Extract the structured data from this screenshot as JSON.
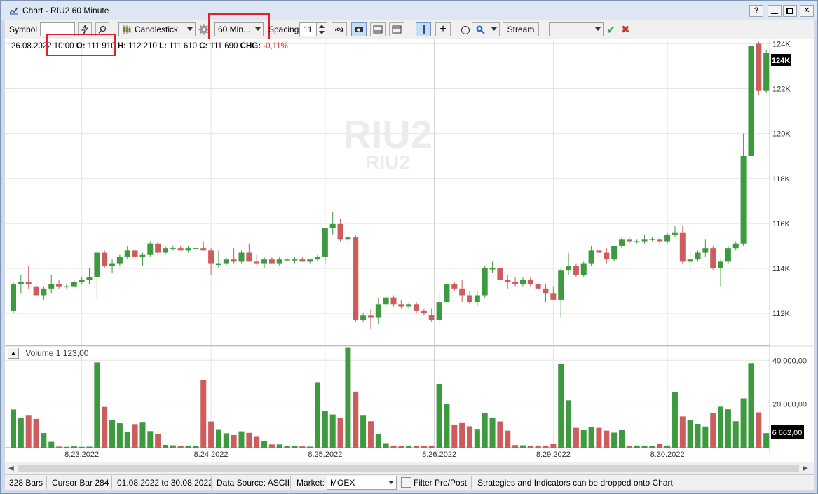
{
  "window": {
    "title": "Chart - RIU2 60 Minute",
    "help": "?",
    "minimize": "—",
    "maximize": "□",
    "close": "✕"
  },
  "toolbar": {
    "symbol_label": "Symbol",
    "symbol_value": "",
    "chart_style": "Candlestick",
    "timeframe": "60 Min...",
    "spacing_label": "Spacing",
    "spacing_value": "11",
    "log_label": "log",
    "stream_label": "Stream",
    "strategy_value": ""
  },
  "info": {
    "date": "26.08.2022",
    "time": "10:00",
    "o_label": "O:",
    "o_value": "111 910",
    "h_label": "H:",
    "h_value": "112 210",
    "l_label": "L:",
    "l_value": "111 610",
    "c_label": "C:",
    "c_value": "111 690",
    "chg_label": "CHG:",
    "chg_value": "-0,11%"
  },
  "watermark": {
    "big": "RIU2",
    "small": "RIU2"
  },
  "volume_panel": {
    "label": "Volume 1 123,00",
    "last_value_label": "6 662,00"
  },
  "price_tag": "124K",
  "status": {
    "bars": "328 Bars",
    "cursor": "Cursor Bar 284",
    "range": "01.08.2022 to 30.08.2022",
    "source": "Data Source: ASCII",
    "market_label": "Market:",
    "market_value": "MOEX",
    "filter_label": "Filter Pre/Post",
    "hint": "Strategies and Indicators can be dropped onto Chart"
  },
  "colors": {
    "up": "#3e9a3e",
    "down": "#cd5c5c",
    "grid": "#e4e4e4",
    "crosshair": "#c8c8c8",
    "highlight": "#e0202c"
  },
  "chart_data": [
    {
      "type": "candlestick",
      "series": [
        {
          "name": "RIU2",
          "values": [
            {
              "o": 112100,
              "h": 113400,
              "l": 112000,
              "c": 113300
            },
            {
              "o": 113300,
              "h": 113700,
              "l": 112900,
              "c": 113400
            },
            {
              "o": 113400,
              "h": 114100,
              "l": 113100,
              "c": 113300
            },
            {
              "o": 113200,
              "h": 113500,
              "l": 112700,
              "c": 112800
            },
            {
              "o": 112800,
              "h": 113200,
              "l": 112600,
              "c": 113100
            },
            {
              "o": 113100,
              "h": 113700,
              "l": 112900,
              "c": 113300
            },
            {
              "o": 113300,
              "h": 113500,
              "l": 113100,
              "c": 113200
            },
            {
              "o": 113200,
              "h": 113300,
              "l": 113100,
              "c": 113200
            },
            {
              "o": 113200,
              "h": 113500,
              "l": 113100,
              "c": 113400
            },
            {
              "o": 113400,
              "h": 113600,
              "l": 113300,
              "c": 113500
            },
            {
              "o": 113500,
              "h": 114000,
              "l": 113300,
              "c": 113600
            },
            {
              "o": 113600,
              "h": 114800,
              "l": 112700,
              "c": 114700
            },
            {
              "o": 114700,
              "h": 114800,
              "l": 114000,
              "c": 114100
            },
            {
              "o": 114100,
              "h": 114400,
              "l": 113800,
              "c": 114200
            },
            {
              "o": 114200,
              "h": 114600,
              "l": 114100,
              "c": 114500
            },
            {
              "o": 114500,
              "h": 115000,
              "l": 114400,
              "c": 114800
            },
            {
              "o": 114800,
              "h": 115000,
              "l": 114400,
              "c": 114500
            },
            {
              "o": 114500,
              "h": 114700,
              "l": 114100,
              "c": 114600
            },
            {
              "o": 114600,
              "h": 115200,
              "l": 114500,
              "c": 115100
            },
            {
              "o": 115100,
              "h": 115200,
              "l": 114600,
              "c": 114700
            },
            {
              "o": 114700,
              "h": 115000,
              "l": 114600,
              "c": 114900
            },
            {
              "o": 114900,
              "h": 115000,
              "l": 114800,
              "c": 114900
            },
            {
              "o": 114900,
              "h": 115000,
              "l": 114800,
              "c": 114800
            },
            {
              "o": 114800,
              "h": 115000,
              "l": 114700,
              "c": 114900
            },
            {
              "o": 114900,
              "h": 115000,
              "l": 114800,
              "c": 114900
            },
            {
              "o": 114900,
              "h": 115200,
              "l": 114800,
              "c": 114800
            },
            {
              "o": 114800,
              "h": 114900,
              "l": 113700,
              "c": 114200
            },
            {
              "o": 114200,
              "h": 114800,
              "l": 114000,
              "c": 114200
            },
            {
              "o": 114200,
              "h": 114500,
              "l": 114100,
              "c": 114400
            },
            {
              "o": 114400,
              "h": 114900,
              "l": 114200,
              "c": 114300
            },
            {
              "o": 114300,
              "h": 114800,
              "l": 114200,
              "c": 114700
            },
            {
              "o": 114700,
              "h": 115100,
              "l": 114300,
              "c": 114300
            },
            {
              "o": 114300,
              "h": 114600,
              "l": 114100,
              "c": 114200
            },
            {
              "o": 114200,
              "h": 114500,
              "l": 114000,
              "c": 114400
            },
            {
              "o": 114400,
              "h": 114500,
              "l": 114200,
              "c": 114200
            },
            {
              "o": 114200,
              "h": 114500,
              "l": 114100,
              "c": 114400
            },
            {
              "o": 114400,
              "h": 114500,
              "l": 114300,
              "c": 114400
            },
            {
              "o": 114400,
              "h": 114500,
              "l": 114200,
              "c": 114400
            },
            {
              "o": 114400,
              "h": 114500,
              "l": 114300,
              "c": 114300
            },
            {
              "o": 114300,
              "h": 114400,
              "l": 114200,
              "c": 114400
            },
            {
              "o": 114400,
              "h": 114600,
              "l": 114300,
              "c": 114500
            },
            {
              "o": 114500,
              "h": 115800,
              "l": 114200,
              "c": 115800
            },
            {
              "o": 115800,
              "h": 116500,
              "l": 115500,
              "c": 116000
            },
            {
              "o": 116000,
              "h": 116200,
              "l": 115200,
              "c": 115300
            },
            {
              "o": 115300,
              "h": 115500,
              "l": 115100,
              "c": 115400
            },
            {
              "o": 115400,
              "h": 115500,
              "l": 111600,
              "c": 111700
            },
            {
              "o": 111700,
              "h": 112000,
              "l": 111600,
              "c": 111900
            },
            {
              "o": 111900,
              "h": 112200,
              "l": 111300,
              "c": 111800
            },
            {
              "o": 111800,
              "h": 112700,
              "l": 111500,
              "c": 112400
            },
            {
              "o": 112400,
              "h": 112800,
              "l": 112200,
              "c": 112700
            },
            {
              "o": 112700,
              "h": 112800,
              "l": 112300,
              "c": 112400
            },
            {
              "o": 112400,
              "h": 112600,
              "l": 112200,
              "c": 112300
            },
            {
              "o": 112300,
              "h": 112500,
              "l": 112200,
              "c": 112400
            },
            {
              "o": 112400,
              "h": 112500,
              "l": 112000,
              "c": 112100
            },
            {
              "o": 112100,
              "h": 112200,
              "l": 111900,
              "c": 112000
            },
            {
              "o": 111910,
              "h": 112210,
              "l": 111610,
              "c": 111690
            },
            {
              "o": 111700,
              "h": 113000,
              "l": 111500,
              "c": 112500
            },
            {
              "o": 112500,
              "h": 113400,
              "l": 112300,
              "c": 113300
            },
            {
              "o": 113300,
              "h": 113400,
              "l": 113000,
              "c": 113100
            },
            {
              "o": 113100,
              "h": 113500,
              "l": 112500,
              "c": 112800
            },
            {
              "o": 112800,
              "h": 113000,
              "l": 112400,
              "c": 112500
            },
            {
              "o": 112500,
              "h": 113000,
              "l": 112300,
              "c": 112800
            },
            {
              "o": 112800,
              "h": 114100,
              "l": 112700,
              "c": 114000
            },
            {
              "o": 114000,
              "h": 114300,
              "l": 113800,
              "c": 114000
            },
            {
              "o": 114000,
              "h": 114300,
              "l": 113300,
              "c": 113500
            },
            {
              "o": 113500,
              "h": 113700,
              "l": 113100,
              "c": 113400
            },
            {
              "o": 113400,
              "h": 113600,
              "l": 113200,
              "c": 113300
            },
            {
              "o": 113300,
              "h": 113600,
              "l": 113200,
              "c": 113500
            },
            {
              "o": 113500,
              "h": 113600,
              "l": 113200,
              "c": 113300
            },
            {
              "o": 113300,
              "h": 113400,
              "l": 113000,
              "c": 113100
            },
            {
              "o": 113100,
              "h": 113300,
              "l": 112500,
              "c": 112900
            },
            {
              "o": 112900,
              "h": 113200,
              "l": 112600,
              "c": 112600
            },
            {
              "o": 112600,
              "h": 114000,
              "l": 111800,
              "c": 113900
            },
            {
              "o": 113900,
              "h": 114700,
              "l": 113700,
              "c": 114100
            },
            {
              "o": 114100,
              "h": 114200,
              "l": 113600,
              "c": 113700
            },
            {
              "o": 113700,
              "h": 114300,
              "l": 113600,
              "c": 114200
            },
            {
              "o": 114200,
              "h": 115000,
              "l": 114100,
              "c": 114800
            },
            {
              "o": 114800,
              "h": 115000,
              "l": 114500,
              "c": 114700
            },
            {
              "o": 114700,
              "h": 114900,
              "l": 114200,
              "c": 114400
            },
            {
              "o": 114400,
              "h": 115000,
              "l": 114300,
              "c": 115000
            },
            {
              "o": 115000,
              "h": 115400,
              "l": 114900,
              "c": 115300
            },
            {
              "o": 115300,
              "h": 115400,
              "l": 115100,
              "c": 115200
            },
            {
              "o": 115200,
              "h": 115300,
              "l": 115100,
              "c": 115200
            },
            {
              "o": 115200,
              "h": 115500,
              "l": 115100,
              "c": 115300
            },
            {
              "o": 115300,
              "h": 115400,
              "l": 115200,
              "c": 115300
            },
            {
              "o": 115300,
              "h": 115400,
              "l": 115100,
              "c": 115200
            },
            {
              "o": 115200,
              "h": 115600,
              "l": 115100,
              "c": 115500
            },
            {
              "o": 115500,
              "h": 115900,
              "l": 115400,
              "c": 115600
            },
            {
              "o": 115600,
              "h": 115900,
              "l": 114200,
              "c": 114300
            },
            {
              "o": 114300,
              "h": 114800,
              "l": 113900,
              "c": 114400
            },
            {
              "o": 114400,
              "h": 114800,
              "l": 114300,
              "c": 114700
            },
            {
              "o": 114700,
              "h": 115300,
              "l": 114500,
              "c": 114900
            },
            {
              "o": 114900,
              "h": 115000,
              "l": 113900,
              "c": 114000
            },
            {
              "o": 114000,
              "h": 114400,
              "l": 113200,
              "c": 114300
            },
            {
              "o": 114300,
              "h": 115000,
              "l": 114200,
              "c": 114900
            },
            {
              "o": 114900,
              "h": 115200,
              "l": 114800,
              "c": 115100
            },
            {
              "o": 115100,
              "h": 120000,
              "l": 115000,
              "c": 119000
            },
            {
              "o": 119000,
              "h": 124000,
              "l": 118900,
              "c": 123900
            },
            {
              "o": 124000,
              "h": 124100,
              "l": 121700,
              "c": 121900
            },
            {
              "o": 121900,
              "h": 123700,
              "l": 121800,
              "c": 123600
            }
          ]
        }
      ],
      "x_tick_labels": [
        "8.23.2022",
        "8.24.2022",
        "8.25.2022",
        "8.26.2022",
        "8.29.2022",
        "8.30.2022"
      ],
      "x_tick_bar_index": [
        9,
        26,
        41,
        56,
        71,
        86
      ],
      "y_tick_labels": [
        "112K",
        "114K",
        "116K",
        "118K",
        "120K",
        "122K",
        "124K"
      ],
      "y_ticks": [
        112000,
        114000,
        116000,
        118000,
        120000,
        122000,
        124000
      ],
      "ylim": [
        110600,
        124200
      ],
      "grid": true
    },
    {
      "type": "bar",
      "series": [
        {
          "name": "Volume",
          "values": [
            17500,
            13700,
            15000,
            13200,
            6700,
            2700,
            500,
            400,
            600,
            400,
            500,
            39000,
            18700,
            12600,
            11200,
            7200,
            10800,
            11800,
            7600,
            6200,
            1300,
            1100,
            900,
            1000,
            800,
            31100,
            12000,
            8500,
            6600,
            5800,
            7500,
            6800,
            5300,
            2900,
            1500,
            1500,
            800,
            800,
            600,
            500,
            30000,
            17000,
            15200,
            13700,
            46000,
            25700,
            15000,
            12100,
            6400,
            2100,
            1000,
            900,
            1000,
            1000,
            800,
            1000,
            29200,
            20000,
            10600,
            11600,
            9800,
            8600,
            15800,
            13800,
            12000,
            7800,
            1200,
            1100,
            800,
            1000,
            1000,
            1600,
            38300,
            21700,
            9100,
            8200,
            9500,
            9100,
            7800,
            6900,
            8100,
            1000,
            1000,
            1000,
            800,
            1600,
            1000,
            25600,
            14300,
            12600,
            10900,
            9700,
            15800,
            18800,
            17600,
            12100,
            22600,
            38700,
            16200,
            6662
          ]
        }
      ],
      "up_down": "ud-pattern",
      "y_tick_labels": [
        "20 000,00",
        "40 000,00"
      ],
      "y_ticks": [
        20000,
        40000
      ],
      "ylim": [
        0,
        46500
      ]
    }
  ]
}
